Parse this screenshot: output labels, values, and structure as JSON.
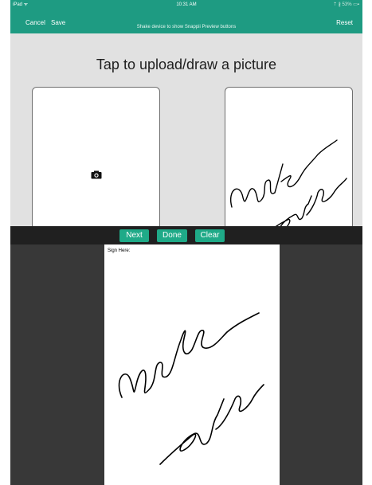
{
  "status_bar": {
    "device": "iPad ᯤ",
    "time": "10:31 AM",
    "right": "⇡ ∦ 53% ▭▪"
  },
  "nav": {
    "cancel": "Cancel",
    "save": "Save",
    "hint": "Shake device to show Snappii Preview buttons",
    "reset": "Reset"
  },
  "main": {
    "title": "Tap to upload/draw a picture",
    "photo_panel_icon": "camera-icon"
  },
  "toolbar": {
    "next": "Next",
    "done": "Done",
    "clear": "Clear"
  },
  "signature": {
    "label": "Sign Here:"
  },
  "colors": {
    "brand_green": "#1e9b82",
    "button_green": "#1faa88",
    "overlay": "#383838"
  }
}
